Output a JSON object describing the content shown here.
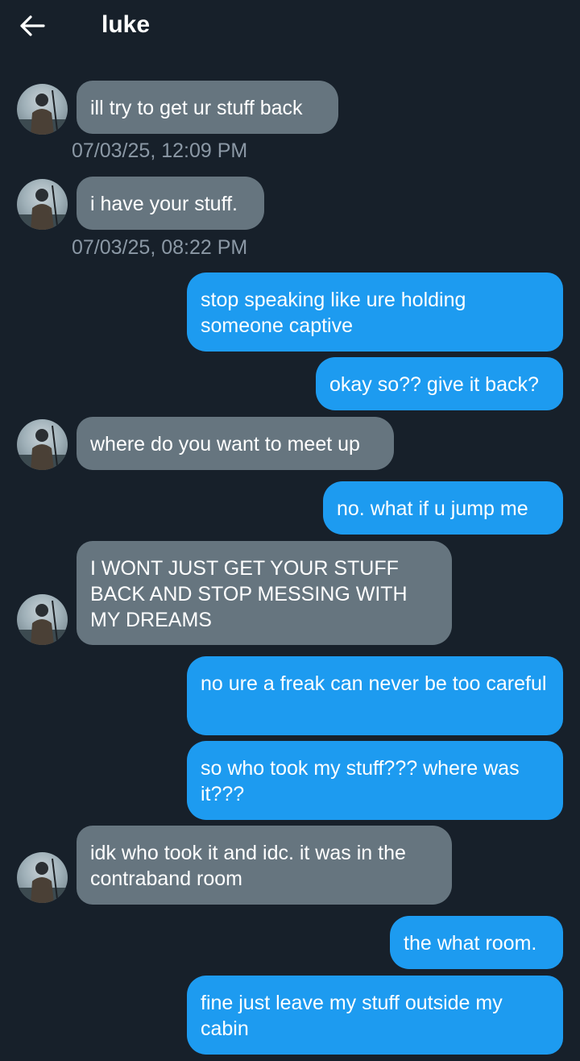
{
  "header": {
    "title": "luke",
    "back_icon": "arrow-left-icon"
  },
  "messages": [
    {
      "side": "received",
      "text": "ill try to get ur stuff back",
      "timestamp": "07/03/25, 12:09 PM"
    },
    {
      "side": "received",
      "text": "i have your stuff.",
      "timestamp": "07/03/25, 08:22 PM"
    },
    {
      "side": "sent",
      "text": "stop speaking like ure holding someone captive"
    },
    {
      "side": "sent",
      "text": "okay so?? give it back?"
    },
    {
      "side": "received",
      "text": "where do you want to meet up"
    },
    {
      "side": "sent",
      "text": "no. what if u jump me"
    },
    {
      "side": "received",
      "text": "I WONT JUST GET YOUR STUFF BACK AND STOP MESSING WITH MY DREAMS"
    },
    {
      "side": "sent",
      "text": "no ure a freak can never be too careful"
    },
    {
      "side": "sent",
      "text": "so who took my stuff??? where was it???"
    },
    {
      "side": "received",
      "text": "idk who took it and idc. it was in the contraband room"
    },
    {
      "side": "sent",
      "text": "the what room."
    },
    {
      "side": "sent",
      "text": "fine just leave my stuff outside my cabin"
    }
  ],
  "colors": {
    "background": "#17202a",
    "received_bubble": "#66757f",
    "sent_bubble": "#1d9bf0",
    "timestamp": "#8b98a5"
  }
}
